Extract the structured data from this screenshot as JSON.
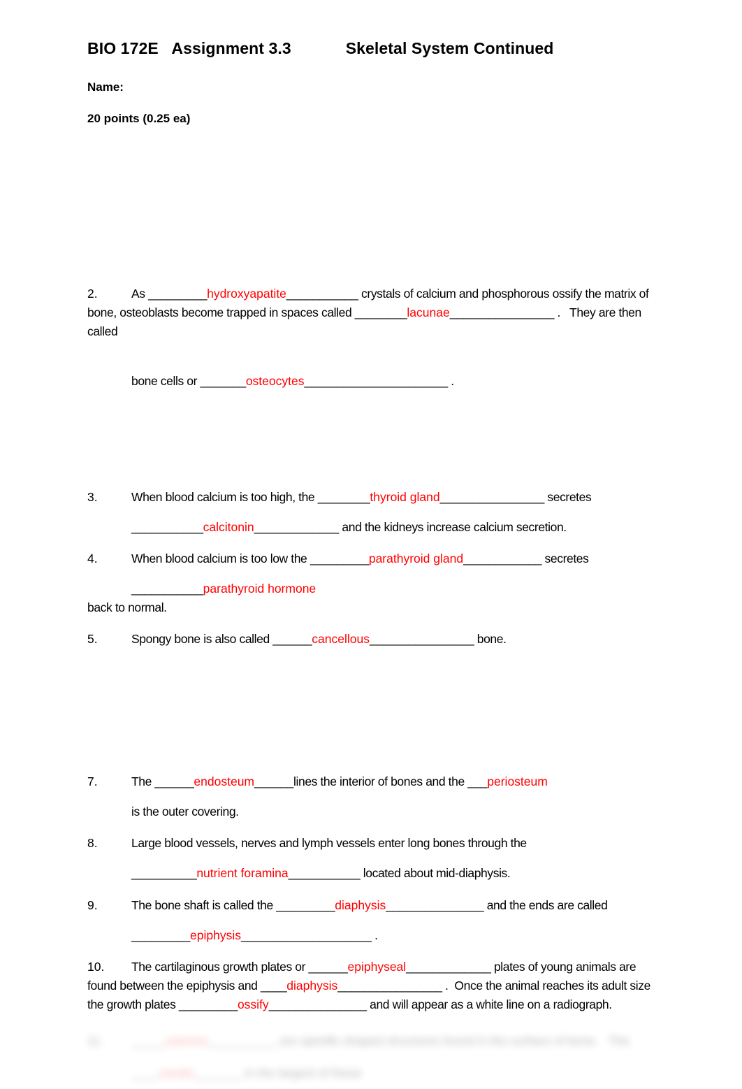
{
  "document": {
    "course_code": "BIO 172E",
    "assignment": "Assignment 3.3",
    "topic": "Skeletal System Continued",
    "title_line": "BIO 172E   Assignment 3.3            Skeletal System Continued",
    "name_label": "Name:",
    "points_label": "20 points (0.25 ea)",
    "answer_color": "#FF0000",
    "text_color": "#000000",
    "page_background": "#FFFFFF"
  },
  "questions": [
    {
      "number": "2.",
      "lines": [
        {
          "indent": false,
          "segments": [
            {
              "type": "text",
              "value": "As _________"
            },
            {
              "type": "answer",
              "value": "hydroxyapatite"
            },
            {
              "type": "text",
              "value": "___________ crystals of calcium and phosphorous ossify the matrix of bone, osteoblasts become trapped in spaces called ________"
            },
            {
              "type": "answer",
              "value": "lacunae"
            },
            {
              "type": "text",
              "value": "________________ .   They are then called"
            }
          ]
        },
        {
          "indent": true,
          "segments": [
            {
              "type": "text",
              "value": "bone cells or _______"
            },
            {
              "type": "answer",
              "value": "osteocytes"
            },
            {
              "type": "text",
              "value": "______________________ ."
            }
          ]
        }
      ]
    },
    {
      "number": "3.",
      "lines": [
        {
          "indent": false,
          "segments": [
            {
              "type": "text",
              "value": "When blood calcium is too high, the ________"
            },
            {
              "type": "answer",
              "value": "thyroid gland"
            },
            {
              "type": "text",
              "value": "________________ secretes"
            }
          ]
        },
        {
          "indent": true,
          "segments": [
            {
              "type": "text",
              "value": "___________"
            },
            {
              "type": "answer",
              "value": "calcitonin"
            },
            {
              "type": "text",
              "value": "_____________ and the kidneys increase calcium secretion."
            }
          ]
        }
      ]
    },
    {
      "number": "4.",
      "lines": [
        {
          "indent": false,
          "segments": [
            {
              "type": "text",
              "value": "When blood calcium is too low the _________"
            },
            {
              "type": "answer",
              "value": "parathyroid gland"
            },
            {
              "type": "text",
              "value": "____________ secretes"
            }
          ]
        },
        {
          "indent": true,
          "segments": [
            {
              "type": "text",
              "value": "___________"
            },
            {
              "type": "answer",
              "value": "parathyroid hormone"
            }
          ]
        },
        {
          "indent": false,
          "no_number": true,
          "segments": [
            {
              "type": "text",
              "value": "back to normal."
            }
          ]
        }
      ]
    },
    {
      "number": "5.",
      "lines": [
        {
          "indent": false,
          "segments": [
            {
              "type": "text",
              "value": "Spongy bone is also called ______"
            },
            {
              "type": "answer",
              "value": "cancellous"
            },
            {
              "type": "text",
              "value": "________________ bone."
            }
          ]
        }
      ]
    },
    {
      "number": "7.",
      "lines": [
        {
          "indent": false,
          "segments": [
            {
              "type": "text",
              "value": "The ______"
            },
            {
              "type": "answer",
              "value": "endosteum"
            },
            {
              "type": "text",
              "value": "______lines the interior of bones and the ___"
            },
            {
              "type": "answer",
              "value": "periosteum"
            }
          ]
        },
        {
          "indent": true,
          "segments": [
            {
              "type": "text",
              "value": "is the outer covering."
            }
          ]
        }
      ]
    },
    {
      "number": "8.",
      "lines": [
        {
          "indent": false,
          "segments": [
            {
              "type": "text",
              "value": "Large blood vessels, nerves and lymph vessels enter long bones through the"
            }
          ]
        },
        {
          "indent": true,
          "segments": [
            {
              "type": "text",
              "value": "__________"
            },
            {
              "type": "answer",
              "value": "nutrient foramina"
            },
            {
              "type": "text",
              "value": "___________ located about mid-diaphysis."
            }
          ]
        }
      ]
    },
    {
      "number": "9.",
      "lines": [
        {
          "indent": false,
          "segments": [
            {
              "type": "text",
              "value": "The bone shaft is called the _________"
            },
            {
              "type": "answer",
              "value": "diaphysis"
            },
            {
              "type": "text",
              "value": "_______________ and the ends are called"
            }
          ]
        },
        {
          "indent": true,
          "segments": [
            {
              "type": "text",
              "value": "_________"
            },
            {
              "type": "answer",
              "value": "epiphysis"
            },
            {
              "type": "text",
              "value": "____________________ ."
            }
          ]
        }
      ]
    },
    {
      "number": "10.",
      "lines": [
        {
          "indent": false,
          "segments": [
            {
              "type": "text",
              "value": "The cartilaginous growth plates or ______"
            },
            {
              "type": "answer",
              "value": "epiphyseal"
            },
            {
              "type": "text",
              "value": "_____________ plates of young animals are found between the epiphysis and ____"
            },
            {
              "type": "answer",
              "value": "diaphysis"
            },
            {
              "type": "text",
              "value": "________________ .  Once the animal reaches its adult size the growth plates _________"
            },
            {
              "type": "answer",
              "value": "ossify"
            },
            {
              "type": "text",
              "value": "_______________ and will appear as a white line on a radiograph."
            }
          ]
        }
      ]
    }
  ],
  "ghosts": {
    "above_q2": "____________________________________________________",
    "above_q7": "_________________________"
  },
  "blurred_footer": {
    "number": "11.",
    "line1_prefix": "_____",
    "line1_answer": "osteons",
    "line1_mid": "__________",
    "line1_rest": "are spindle shaped structures found in the surface of bone.   The",
    "line2_prefix": "____",
    "line2_answer": "canals",
    "line2_mid": "_______",
    "line2_rest": "in the largest of these"
  }
}
